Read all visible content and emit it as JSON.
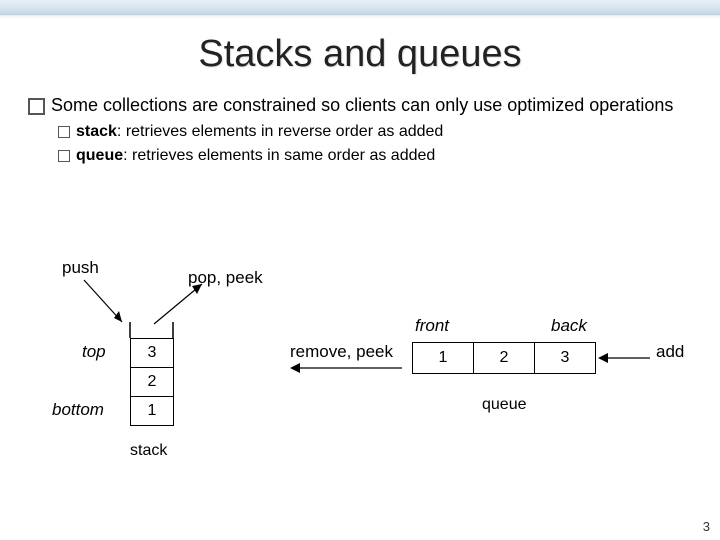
{
  "title": "Stacks and queues",
  "main_bullet": "Some collections are constrained so clients can only use optimized operations",
  "sub_bullets": [
    {
      "term": "stack",
      "desc": ": retrieves elements in reverse order as added"
    },
    {
      "term": "queue",
      "desc": ": retrieves elements in same order as added"
    }
  ],
  "stack": {
    "push_label": "push",
    "pop_label": "pop, peek",
    "top_label": "top",
    "bottom_label": "bottom",
    "caption": "stack",
    "cells": [
      "3",
      "2",
      "1"
    ]
  },
  "queue": {
    "front_label": "front",
    "back_label": "back",
    "remove_label": "remove, peek",
    "add_label": "add",
    "caption": "queue",
    "cells": [
      "1",
      "2",
      "3"
    ]
  },
  "page_number": "3"
}
